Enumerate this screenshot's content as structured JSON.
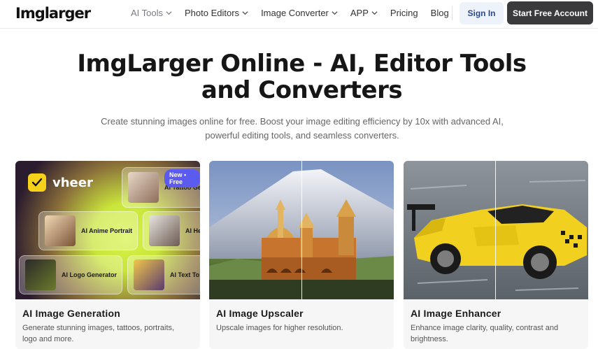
{
  "header": {
    "logo": "Imglarger",
    "nav": [
      {
        "label": "AI Tools",
        "dropdown": true,
        "active": true
      },
      {
        "label": "Photo Editors",
        "dropdown": true,
        "active": false
      },
      {
        "label": "Image Converter",
        "dropdown": true,
        "active": false
      },
      {
        "label": "APP",
        "dropdown": true,
        "active": false
      },
      {
        "label": "Pricing",
        "dropdown": false,
        "active": false
      },
      {
        "label": "Blog",
        "dropdown": false,
        "active": false
      }
    ],
    "sign_in": "Sign In",
    "start": "Start Free Account"
  },
  "hero": {
    "title_line1": "ImgLarger Online - AI, Editor Tools",
    "title_line2": "and Converters",
    "subtitle_line1": "Create stunning images online for free. Boost your image editing efficiency by 10x with advanced AI,",
    "subtitle_line2": "powerful editing tools, and seamless converters."
  },
  "cards": [
    {
      "title": "AI Image Generation",
      "desc_line1": "Generate stunning images, tattoos, portraits,",
      "desc_line2": "logo and more.",
      "promo": {
        "brand": "vheer",
        "badge": "New • Free",
        "tiles": [
          "AI Tattoo Ge",
          "AI Anime Portrait",
          "AI He",
          "AI Logo Generator",
          "AI Text To I"
        ]
      }
    },
    {
      "title": "AI Image Upscaler",
      "desc_line1": "Upscale images for higher resolution.",
      "desc_line2": ""
    },
    {
      "title": "AI Image Enhancer",
      "desc_line1": "Enhance image clarity, quality, contrast and",
      "desc_line2": "brightness."
    }
  ],
  "colors": {
    "primary_dark": "#3a3a3c",
    "signin_bg": "#eef2fb",
    "badge_purple": "#5b5bf0",
    "vheer_yellow": "#f7d21b"
  }
}
